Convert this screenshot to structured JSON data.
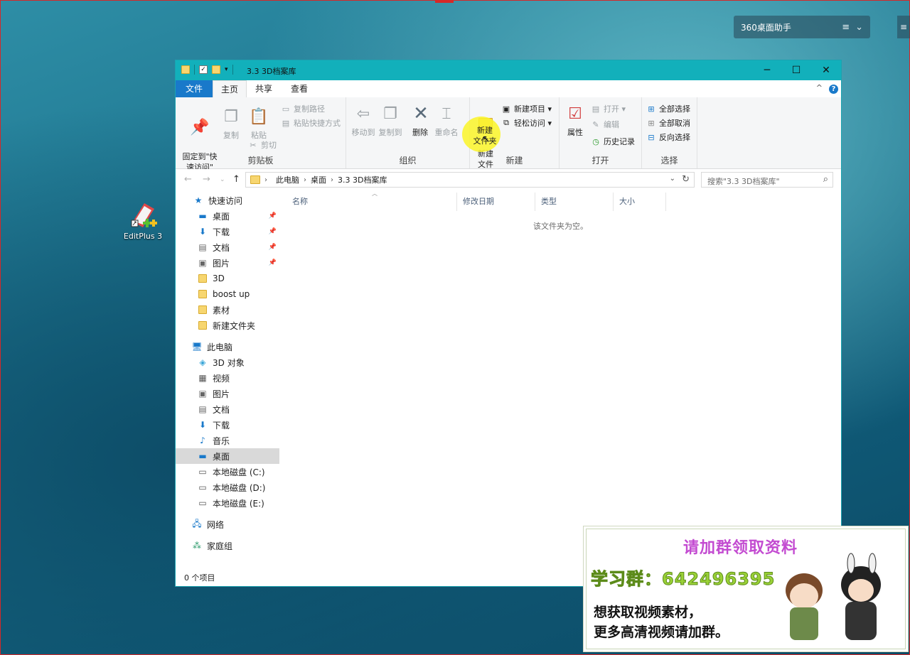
{
  "desktop": {
    "widget_360_title": "360桌面助手",
    "widget_menu_icon": "≡",
    "widget_chevron_icon": "⌄",
    "edge_icon": "≡",
    "icon_editplus_label": "EditPlus 3"
  },
  "window": {
    "title": "3.3 3D档案库",
    "minimize": "─",
    "maximize": "☐",
    "close": "✕",
    "help": "?",
    "collapse": "^"
  },
  "tabs": [
    "文件",
    "主页",
    "共享",
    "查看"
  ],
  "ribbon": {
    "clipboard": {
      "label": "剪贴板",
      "pin_quick": "固定到\"快\n速访问\"",
      "copy": "复制",
      "paste": "粘贴",
      "copy_path": "复制路径",
      "paste_shortcut": "粘贴快捷方式",
      "cut": "剪切"
    },
    "organize": {
      "label": "组织",
      "move_to": "移动到",
      "copy_to": "复制到",
      "delete": "删除",
      "rename": "重命名"
    },
    "new": {
      "label": "新建",
      "new_folder": "新建\n文件夹",
      "new_item": "新建项目 ▾",
      "easy_access": "轻松访问 ▾"
    },
    "open": {
      "label": "打开",
      "properties": "属性",
      "open": "打开 ▾",
      "edit": "编辑",
      "history": "历史记录"
    },
    "select": {
      "label": "选择",
      "select_all": "全部选择",
      "select_none": "全部取消",
      "invert": "反向选择"
    }
  },
  "address": {
    "crumbs": [
      "此电脑",
      "桌面",
      "3.3 3D档案库"
    ],
    "search_placeholder": "搜索\"3.3 3D档案库\""
  },
  "nav": {
    "quick_access": "快速访问",
    "quick_items": [
      "桌面",
      "下载",
      "文档",
      "图片",
      "3D",
      "boost up",
      "素材",
      "新建文件夹"
    ],
    "this_pc": "此电脑",
    "pc_items": [
      "3D 对象",
      "视频",
      "图片",
      "文档",
      "下载",
      "音乐",
      "桌面",
      "本地磁盘 (C:)",
      "本地磁盘 (D:)",
      "本地磁盘 (E:)"
    ],
    "network": "网络",
    "homegroup": "家庭组"
  },
  "columns": [
    "名称",
    "修改日期",
    "类型",
    "大小"
  ],
  "empty_message": "该文件夹为空。",
  "status_bar": "0 个项目",
  "ad": {
    "title": "请加群领取资料",
    "group": "学习群：642496395",
    "line1": "想获取视频素材，",
    "line2": "更多高清视频请加群。"
  },
  "colors": {
    "accent": "#1979ca",
    "titlebar": "#12b0bb",
    "ad_title": "#c34bd1",
    "ad_group": "#9ad137"
  }
}
